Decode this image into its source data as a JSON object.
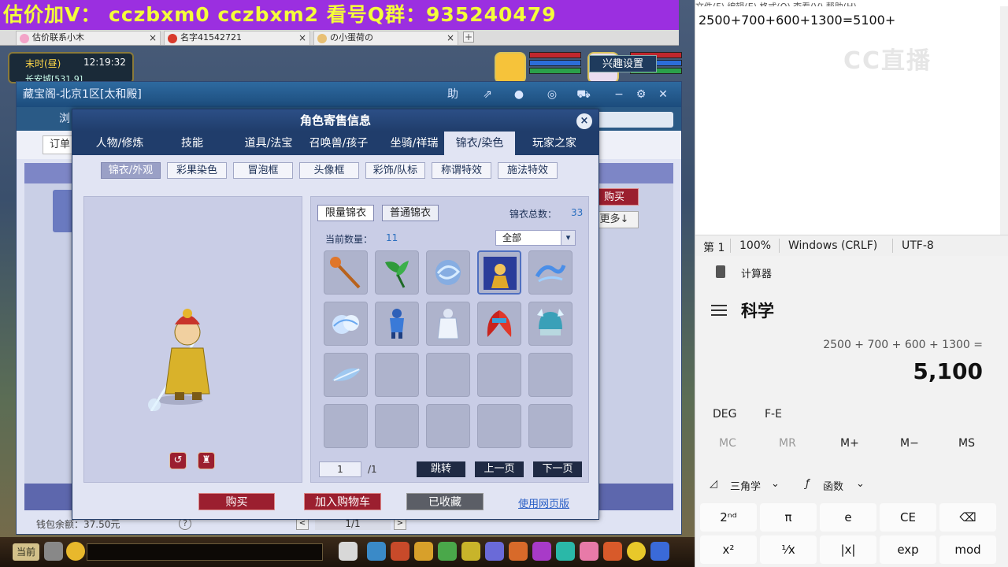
{
  "banner": {
    "text": "估价加V： cczbxm0  cczbxm2  看号Q群：935240479"
  },
  "browser": {
    "tabs": [
      {
        "label": "估价联系小木"
      },
      {
        "label": "名字41542721"
      },
      {
        "label": "の小蛋荷の"
      }
    ],
    "close": "×",
    "add": "+"
  },
  "hud": {
    "time_label": "末时(昼)",
    "clock": "12:19:32",
    "location": "长安城[531,9]"
  },
  "cbg": {
    "title": "藏宝阁-北京1区[太和殿]",
    "controls": [
      "助",
      "⇗",
      "●",
      "◎",
      "⛟",
      "−",
      "⚙",
      "✕"
    ],
    "nav_text": "浏",
    "order_button": "订单",
    "interest_button": "兴趣设置",
    "buy_button": "购买",
    "more_button": "更多↓",
    "wallet": "钱包余额：37.50元",
    "wallet_help": "?",
    "pager": {
      "prev": "<",
      "value": "1/1",
      "next": ">"
    }
  },
  "dialog": {
    "title": "角色寄售信息",
    "close": "×",
    "tabs": [
      "人物/修炼",
      "技能",
      "道具/法宝",
      "召唤兽/孩子",
      "坐骑/祥瑞",
      "锦衣/染色",
      "玩家之家"
    ],
    "active_tab": 5,
    "subtabs": [
      "锦衣/外观",
      "彩果染色",
      "冒泡框",
      "头像框",
      "彩饰/队标",
      "称谓特效",
      "施法特效"
    ],
    "active_subtab": 0,
    "char_buttons": [
      "↺",
      "♜"
    ],
    "wardrobe": {
      "tab_limited": "限量锦衣",
      "tab_normal": "普通锦衣",
      "total_label": "锦衣总数：",
      "total": "33",
      "current_label": "当前数量：",
      "current": "11",
      "filter": "全部",
      "filter_chevron": "▾",
      "items": [
        "staff",
        "leaf",
        "swirl",
        "portrait",
        "wave",
        "cloud",
        "knight",
        "robe",
        "wing",
        "helmet",
        "feather"
      ],
      "empty_cells": 9,
      "page": "1",
      "page_total": "/1",
      "jump": "跳转",
      "prev": "上一页",
      "next": "下一页"
    },
    "buttons": {
      "buy": "购买",
      "add_cart": "加入购物车",
      "favorited": "已收藏",
      "web_link": "使用网页版"
    }
  },
  "bottombar": {
    "channel": "当前"
  },
  "notepad": {
    "menu": "文件(F)  编辑(E)  格式(O)  查看(V)  帮助(H)",
    "text": "2500+700+600+1300=5100+",
    "watermark": "CC直播",
    "status": {
      "pos": "第 1",
      "zoom": "100%",
      "eol": "Windows (CRLF)",
      "enc": "UTF-8"
    }
  },
  "calculator": {
    "title": "计算器",
    "mode": "科学",
    "expression": "2500 + 700 + 600 + 1300 =",
    "result": "5,100",
    "deg": "DEG",
    "fe": "F-E",
    "memory": [
      "MC",
      "MR",
      "M+",
      "M−",
      "MS"
    ],
    "trig": "三角学",
    "func": "函数",
    "keys_row1": [
      "2ⁿᵈ",
      "π",
      "e",
      "CE",
      "⌫"
    ],
    "keys_row2": [
      "x²",
      "¹⁄x",
      "|x|",
      "exp",
      "mod"
    ]
  }
}
